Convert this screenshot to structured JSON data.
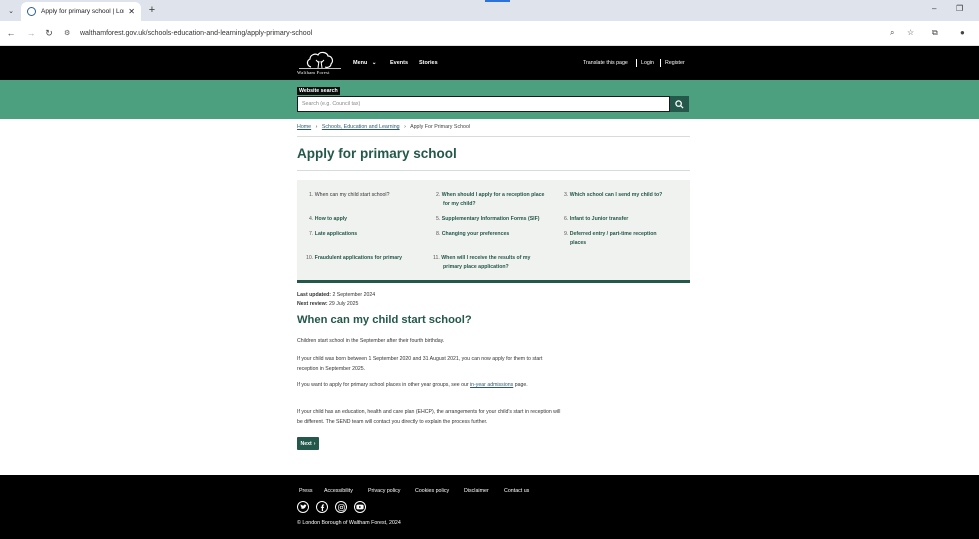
{
  "browser": {
    "tab_title": "Apply for primary school | Lond",
    "new_tab_symbol": "+",
    "url": "walthamforest.gov.uk/schools-education-and-learning/apply-primary-school"
  },
  "header": {
    "logo_text": "Waltham Forest",
    "nav": {
      "menu": "Menu",
      "events": "Events",
      "stories": "Stories",
      "translate": "Translate this page",
      "login": "Login",
      "register": "Register"
    }
  },
  "search": {
    "label": "Website search",
    "placeholder": "Search (e.g. Council tax)"
  },
  "breadcrumb": {
    "home": "Home",
    "section": "Schools, Education and Learning",
    "current": "Apply For Primary School"
  },
  "page_title": "Apply for primary school",
  "toc": [
    {
      "num": "1.",
      "label": "When can my child start school?"
    },
    {
      "num": "2.",
      "label": "When should I apply for a reception place",
      "label2": "for my child?"
    },
    {
      "num": "3.",
      "label": "Which school can I send my child to?"
    },
    {
      "num": "4.",
      "label": "How to apply"
    },
    {
      "num": "5.",
      "label": "Supplementary Information Forms (SIF)"
    },
    {
      "num": "6.",
      "label": "Infant to Junior transfer"
    },
    {
      "num": "7.",
      "label": "Late applications"
    },
    {
      "num": "8.",
      "label": "Changing your preferences"
    },
    {
      "num": "9.",
      "label": "Deferred entry / part-time reception",
      "label2": "places"
    },
    {
      "num": "10.",
      "label": "Fraudulent applications for primary"
    },
    {
      "num": "11.",
      "label": "When will I receive the results of my",
      "label2": "primary place application?"
    }
  ],
  "meta": {
    "updated_label": "Last updated:",
    "updated_value": " 2 September 2024",
    "review_label": "Next review:",
    "review_value": " 29 July 2025"
  },
  "section": {
    "title": "When can my child start school?",
    "p1": "Children start school in the September after their fourth birthday.",
    "p2": "If your child was born between 1 September 2020 and 31 August 2021, you can now apply for them to start reception in September 2025.",
    "p3_before": "If you want to apply for primary school places in other year groups, see our ",
    "p3_link": "in-year admissions",
    "p3_after": " page.",
    "p4": "If your child has an education, health and care plan (EHCP), the arrangements for your child's start in reception will be different. The SEND team will contact you directly to explain the process further."
  },
  "next_label": "Next",
  "footer": {
    "links": [
      "Press",
      "Accessibility",
      "Privacy policy",
      "Cookies policy",
      "Disclaimer",
      "Contact us"
    ],
    "social_icons": [
      "twitter-icon",
      "facebook-icon",
      "instagram-icon",
      "youtube-icon"
    ],
    "copyright": "© London Borough of Waltham Forest, 2024"
  },
  "colors": {
    "brand_green": "#24584a",
    "search_band": "#4c9f7f",
    "header_bg": "#000000"
  }
}
